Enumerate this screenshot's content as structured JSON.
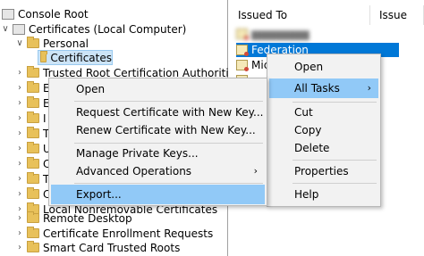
{
  "tree": {
    "items": [
      {
        "label": "Console Root"
      },
      {
        "label": "Certificates (Local Computer)"
      },
      {
        "label": "Personal"
      },
      {
        "label": "Certificates"
      },
      {
        "label": "Trusted Root Certification Authorities"
      },
      {
        "label": "E"
      },
      {
        "label": "E"
      },
      {
        "label": "I"
      },
      {
        "label": "T"
      },
      {
        "label": "U"
      },
      {
        "label": "C"
      },
      {
        "label": "T"
      },
      {
        "label": "C"
      },
      {
        "label": "F"
      },
      {
        "label": "C"
      },
      {
        "label": "Local Nonremovable Certificates"
      },
      {
        "label": "Remote Desktop"
      },
      {
        "label": "Certificate Enrollment Requests"
      },
      {
        "label": "Smart Card Trusted Roots"
      }
    ]
  },
  "list": {
    "headers": [
      "Issued To",
      "Issue"
    ],
    "rows": [
      {
        "label": "Federation",
        "selected": true
      },
      {
        "label": "Mic"
      },
      {
        "label": "sp"
      }
    ]
  },
  "context_menu": {
    "items": [
      "Open",
      "Request Certificate with New Key...",
      "Renew Certificate with New Key...",
      "Manage Private Keys...",
      "Advanced Operations",
      "Export..."
    ],
    "submenu_glyph": "›"
  },
  "all_tasks_menu": {
    "items": [
      "Open",
      "All Tasks",
      "Cut",
      "Copy",
      "Delete",
      "Properties",
      "Help"
    ],
    "submenu_glyph": "›"
  },
  "colors": {
    "selection": "#0078d7",
    "menu_highlight": "#91c9f7",
    "menu_bg": "#f2f2f2"
  }
}
